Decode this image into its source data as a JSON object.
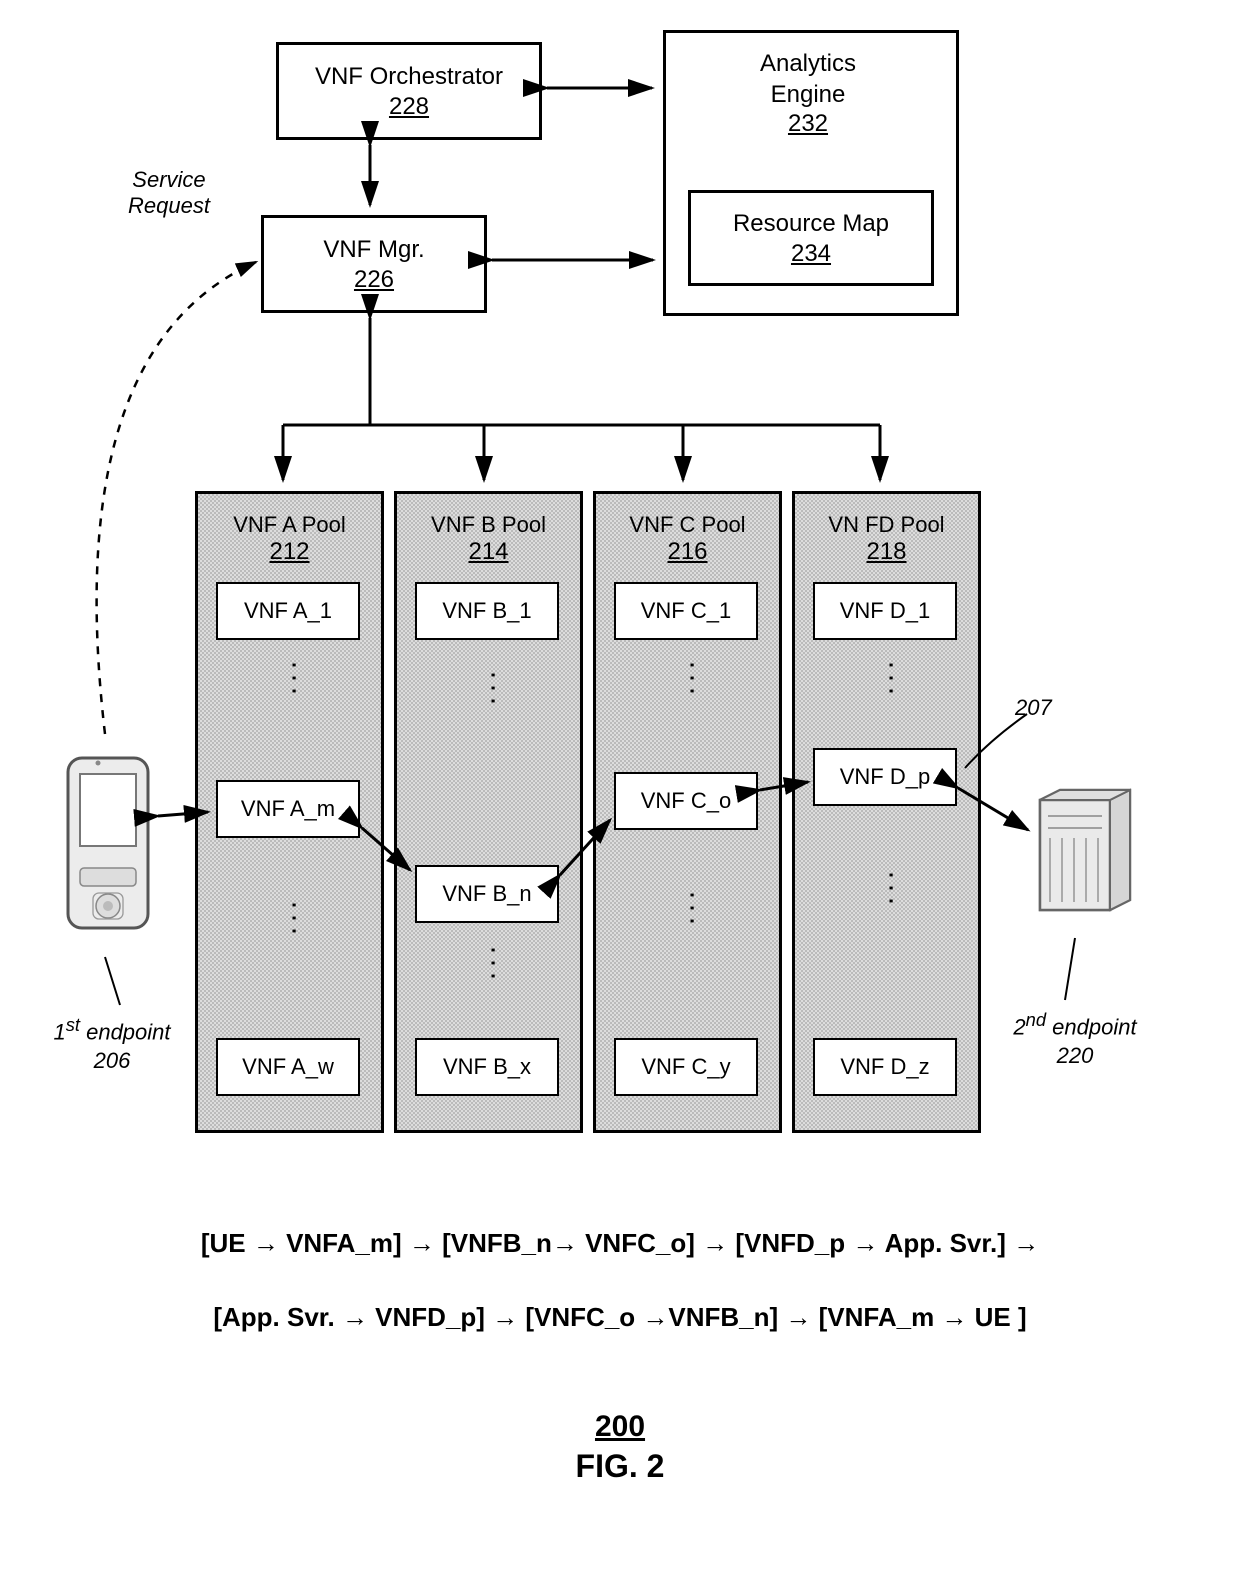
{
  "orchestrator": {
    "title": "VNF Orchestrator",
    "ref": "228"
  },
  "analytics": {
    "title_l1": "Analytics",
    "title_l2": "Engine",
    "ref": "232"
  },
  "resource_map": {
    "title": "Resource Map",
    "ref": "234"
  },
  "vnf_mgr": {
    "title": "VNF Mgr.",
    "ref": "226"
  },
  "service_request": {
    "l1": "Service",
    "l2": "Request"
  },
  "pools": [
    {
      "title": "VNF A Pool",
      "ref": "212",
      "items": [
        "VNF A_1",
        "VNF A_m",
        "VNF A_w"
      ]
    },
    {
      "title": "VNF B Pool",
      "ref": "214",
      "items": [
        "VNF B_1",
        "VNF B_n",
        "VNF B_x"
      ]
    },
    {
      "title": "VNF C Pool",
      "ref": "216",
      "items": [
        "VNF C_o",
        "VNF C_1",
        "VNF C_y"
      ]
    },
    {
      "title": "VN FD Pool",
      "ref": "218",
      "items": [
        "VNF D_1",
        "VNF D_p",
        "VNF D_z"
      ]
    }
  ],
  "endpoint1": {
    "label_l1": "1",
    "label_sup": "st",
    "label_rest": " endpoint",
    "ref": "206"
  },
  "endpoint2": {
    "label_l1": "2",
    "label_sup": "nd",
    "label_rest": " endpoint",
    "ref": "220"
  },
  "ref207": "207",
  "flow": {
    "line1": "[UE → VNFA_m] → [VNFB_n→ VNFC_o] → [VNFD_p → App. Svr.] →",
    "line2": "[App. Svr. → VNFD_p] → [VNFC_o →VNFB_n] → [VNFA_m → UE ]"
  },
  "fig": {
    "num": "200",
    "label": "FIG. 2"
  }
}
